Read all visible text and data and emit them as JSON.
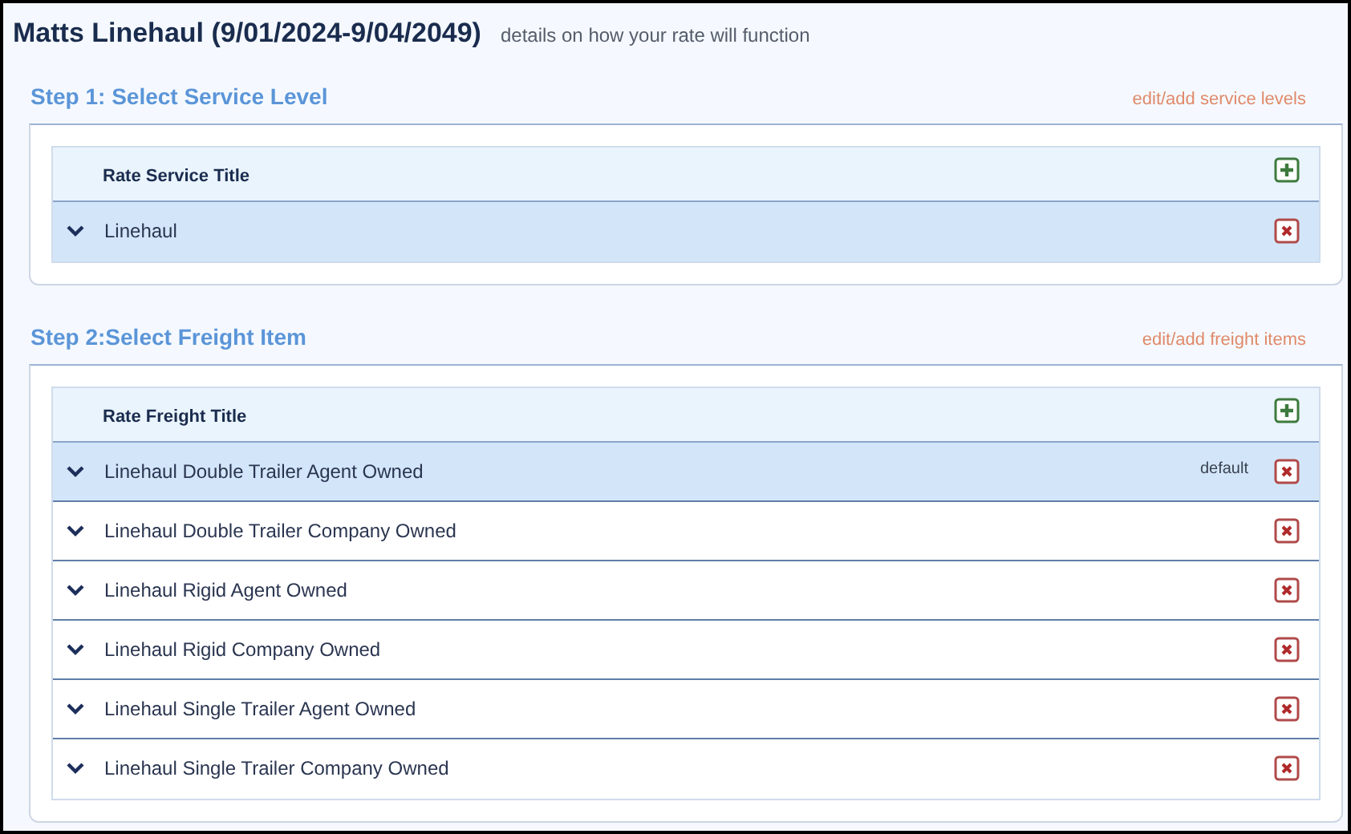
{
  "header": {
    "title": "Matts Linehaul (9/01/2024-9/04/2049)",
    "subtitle": "details on how your rate will function"
  },
  "steps": [
    {
      "title": "Step 1: Select Service Level",
      "link": "edit/add service levels",
      "column": "Rate Service Title",
      "rows": [
        {
          "label": "Linehaul",
          "selected": true
        }
      ]
    },
    {
      "title": "Step 2:Select Freight Item",
      "link": "edit/add freight items",
      "column": "Rate Freight Title",
      "rows": [
        {
          "label": "Linehaul Double Trailer Agent Owned",
          "selected": true,
          "tag": "default"
        },
        {
          "label": "Linehaul Double Trailer Company Owned",
          "selected": false
        },
        {
          "label": "Linehaul Rigid Agent Owned",
          "selected": false
        },
        {
          "label": "Linehaul Rigid Company Owned",
          "selected": false
        },
        {
          "label": "Linehaul Single Trailer Agent Owned",
          "selected": false
        },
        {
          "label": "Linehaul Single Trailer Company Owned",
          "selected": false
        }
      ]
    }
  ]
}
